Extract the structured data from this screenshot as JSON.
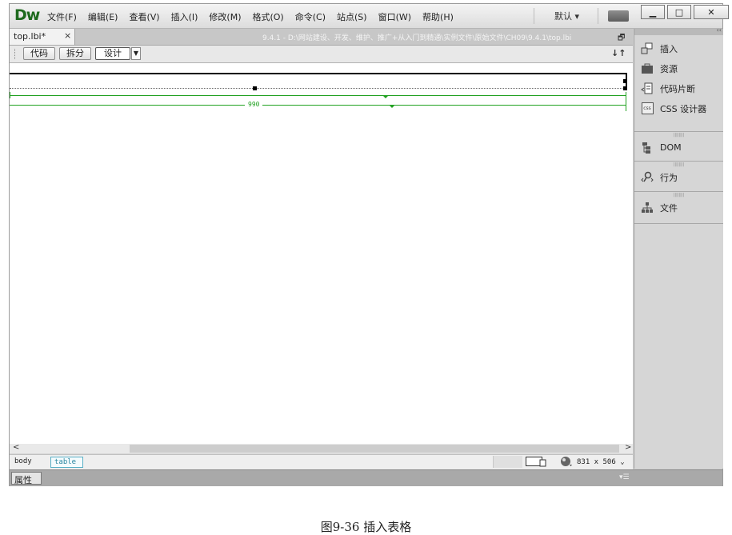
{
  "app": {
    "logo": "Dw",
    "menus": [
      "文件(F)",
      "编辑(E)",
      "查看(V)",
      "插入(I)",
      "修改(M)",
      "格式(O)",
      "命令(C)",
      "站点(S)",
      "窗口(W)",
      "帮助(H)"
    ],
    "workspace": "默认 ▾",
    "window_buttons": [
      "▁",
      "□",
      "✕"
    ]
  },
  "document": {
    "tab_name": "top.lbi*",
    "tab_close": "×",
    "path": "9.4.1 - D:\\网站建设、开发、维护、推广+从入门到精通\\实例文件\\原始文件\\CH09\\9.4.1\\top.lbi",
    "restore": "🗗"
  },
  "view_toolbar": {
    "code": "代码",
    "split": "拆分",
    "design": "设计",
    "dropdown": "▼",
    "sort": "↓↑"
  },
  "canvas": {
    "table_width_label": "990"
  },
  "scroll": {
    "left": "<",
    "right": ">"
  },
  "status": {
    "tag_body": "body",
    "tag_table": "table",
    "window_size": "831 x 506",
    "window_size_arrow": "⌄"
  },
  "properties": {
    "label": "属性",
    "menu": "▾☰"
  },
  "panels": [
    {
      "label": "插入",
      "icon": "insert-icon"
    },
    {
      "label": "资源",
      "icon": "assets-icon"
    },
    {
      "label": "代码片断",
      "icon": "snippets-icon"
    },
    {
      "label": "CSS 设计器",
      "icon": "css-designer-icon"
    },
    {
      "label": "DOM",
      "icon": "dom-icon"
    },
    {
      "label": "行为",
      "icon": "behaviors-icon"
    },
    {
      "label": "文件",
      "icon": "files-icon"
    }
  ],
  "panel_head": {
    "collapse": "‹‹"
  },
  "css_icon_text": "css",
  "caption": "图9-36 插入表格"
}
